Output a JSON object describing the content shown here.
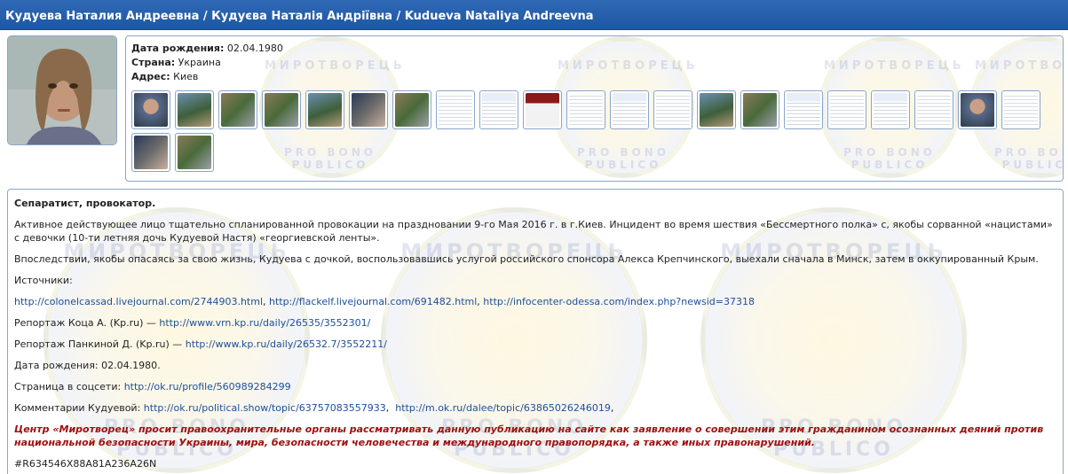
{
  "header": {
    "title": "Кудуева Наталия Андреевна / Кудуєва Наталія Андріївна / Kudueva Nataliya Andreevna"
  },
  "profile": {
    "birth_label": "Дата рождения:",
    "birth_value": "02.04.1980",
    "country_label": "Страна:",
    "country_value": "Украина",
    "address_label": "Адрес:",
    "address_value": "Киев"
  },
  "watermark": {
    "top_text": "МИРОТВОРЕЦЬ",
    "bottom_text": "PRO BONO PUBLICO"
  },
  "gallery": {
    "thumbs": [
      {
        "kind": "face"
      },
      {
        "kind": "photo2"
      },
      {
        "kind": "photo"
      },
      {
        "kind": "photo"
      },
      {
        "kind": "photo2"
      },
      {
        "kind": "dark"
      },
      {
        "kind": "photo"
      },
      {
        "kind": "doc"
      },
      {
        "kind": "doc2"
      },
      {
        "kind": "red"
      },
      {
        "kind": "doc"
      },
      {
        "kind": "doc2"
      },
      {
        "kind": "doc"
      },
      {
        "kind": "photo2"
      },
      {
        "kind": "photo"
      },
      {
        "kind": "doc2"
      },
      {
        "kind": "doc"
      },
      {
        "kind": "doc2"
      },
      {
        "kind": "doc"
      },
      {
        "kind": "face"
      },
      {
        "kind": "doc"
      },
      {
        "kind": "dark"
      },
      {
        "kind": "photo"
      }
    ]
  },
  "description": {
    "heading": "Сепаратист, провокатор.",
    "paragraph1": "Активное действующее лицо тщательно спланированной провокации на праздновании 9-го Мая 2016 г. в г.Киев. Инцидент во время шествия «Бессмертного полка» с, якобы сорванной «нацистами» с девочки (10-ти летняя дочь Кудуевой Настя) «георгиевской ленты».",
    "paragraph2": "Впоследствии, якобы опасаясь за свою жизнь, Кудуева с дочкой, воспользовавшись услугой российского спонсора  Алекса Крепчинского, выехали сначала в Минск, затем в оккупированный Крым.",
    "sources_label": "Источники:",
    "source_link1": "http://colonelcassad.livejournal.com/2744903.html",
    "source_link2": "http://flackelf.livejournal.com/691482.html",
    "source_link3": "http://infocenter-odessa.com/index.php?newsid=37318",
    "report1_label": "Репортаж Коца А. (Kp.ru) — ",
    "report1_link": "http://www.vrn.kp.ru/daily/26535/3552301/",
    "report2_label": "Репортаж Панкиной Д. (Kp.ru) — ",
    "report2_link": "http://www.kp.ru/daily/26532.7/3552211/",
    "birth_line": "Дата рождения: 02.04.1980.",
    "social_label": "Страница в соцсети: ",
    "social_link": "http://ok.ru/profile/560989284299",
    "comments_label": "Комментарии Кудуевой: ",
    "comments_link1": "http://ok.ru/political.show/topic/63757083557933",
    "comments_link2": "http://m.ok.ru/dalee/topic/63865026246019",
    "warning": "Центр «Миротворец» просит правоохранительные органы рассматривать данную публикацию на сайте как заявление о совершении этим гражданином осознанных деяний против национальной безопасности Украины, мира, безопасности человечества и международного правопорядка, а также иных правонарушений.",
    "hash": "#R634546X88A81A236A26N"
  },
  "colors": {
    "header_bg": "#1e56a3",
    "link": "#1d4f9a",
    "warning": "#a01010",
    "border": "#8aa6c9"
  }
}
